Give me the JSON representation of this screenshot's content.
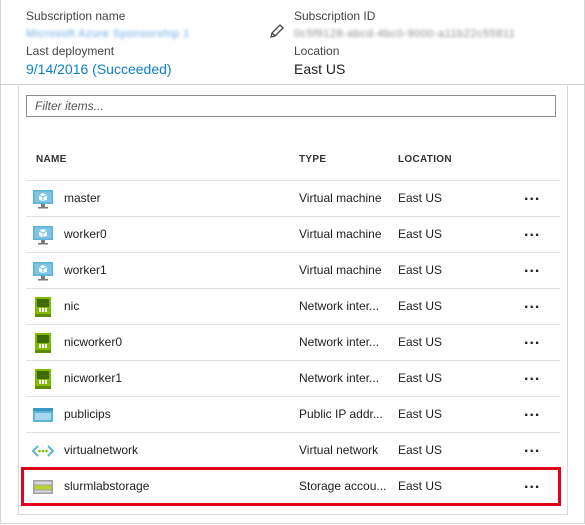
{
  "essentials": {
    "subscription_name_label": "Subscription name",
    "subscription_name_value": "Microsoft Azure Sponsorship 1",
    "subscription_id_label": "Subscription ID",
    "subscription_id_value": "0c5f9128-abcd-4bc0-9000-a11b22c55811",
    "last_deployment_label": "Last deployment",
    "last_deployment_value": "9/14/2016 (Succeeded)",
    "location_label": "Location",
    "location_value": "East US"
  },
  "filter": {
    "placeholder": "Filter items..."
  },
  "columns": {
    "name": "NAME",
    "type": "TYPE",
    "location": "LOCATION"
  },
  "rows": [
    {
      "name": "master",
      "type": "Virtual machine",
      "location": "East US",
      "icon": "virtual-machine-icon",
      "more": "..."
    },
    {
      "name": "worker0",
      "type": "Virtual machine",
      "location": "East US",
      "icon": "virtual-machine-icon",
      "more": "..."
    },
    {
      "name": "worker1",
      "type": "Virtual machine",
      "location": "East US",
      "icon": "virtual-machine-icon",
      "more": "..."
    },
    {
      "name": "nic",
      "type": "Network inter...",
      "location": "East US",
      "icon": "network-interface-icon",
      "more": "..."
    },
    {
      "name": "nicworker0",
      "type": "Network inter...",
      "location": "East US",
      "icon": "network-interface-icon",
      "more": "..."
    },
    {
      "name": "nicworker1",
      "type": "Network inter...",
      "location": "East US",
      "icon": "network-interface-icon",
      "more": "..."
    },
    {
      "name": "publicips",
      "type": "Public IP addr...",
      "location": "East US",
      "icon": "public-ip-icon",
      "more": "..."
    },
    {
      "name": "virtualnetwork",
      "type": "Virtual network",
      "location": "East US",
      "icon": "virtual-network-icon",
      "more": "..."
    },
    {
      "name": "slurmlabstorage",
      "type": "Storage accou...",
      "location": "East US",
      "icon": "storage-account-icon",
      "more": "..."
    }
  ],
  "colors": {
    "link": "#0f80cf",
    "highlight": "#e3001b"
  }
}
